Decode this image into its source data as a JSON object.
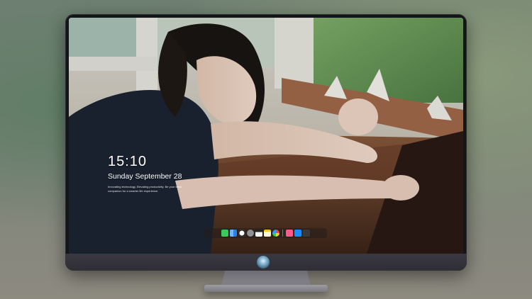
{
  "lock_screen": {
    "time": "15:10",
    "date": "Sunday September 28",
    "tagline": "Innovating technology, Elevating productivity. Be your ideal companion for a smarter life experience."
  },
  "dock": {
    "items": [
      {
        "name": "messages-icon",
        "color": "#3cc85a"
      },
      {
        "name": "finder-icon",
        "color": "#2f7ee0"
      },
      {
        "name": "clock-icon",
        "color": "#ffffff"
      },
      {
        "name": "settings-icon",
        "color": "#8e9096"
      },
      {
        "name": "video-icon",
        "color": "#222222"
      },
      {
        "name": "notes-icon",
        "color": "#f5c431"
      },
      {
        "name": "photos-icon",
        "color": "#39f"
      },
      {
        "name": "music-icon",
        "color": "#fb5b8a"
      },
      {
        "name": "app-store-icon",
        "color": "#1a8cff"
      },
      {
        "name": "camera-icon",
        "color": "#3a3a3d"
      }
    ]
  },
  "colors": {
    "bezel": "#141518",
    "chin": "#3a3840",
    "stand": "#8a8990"
  }
}
